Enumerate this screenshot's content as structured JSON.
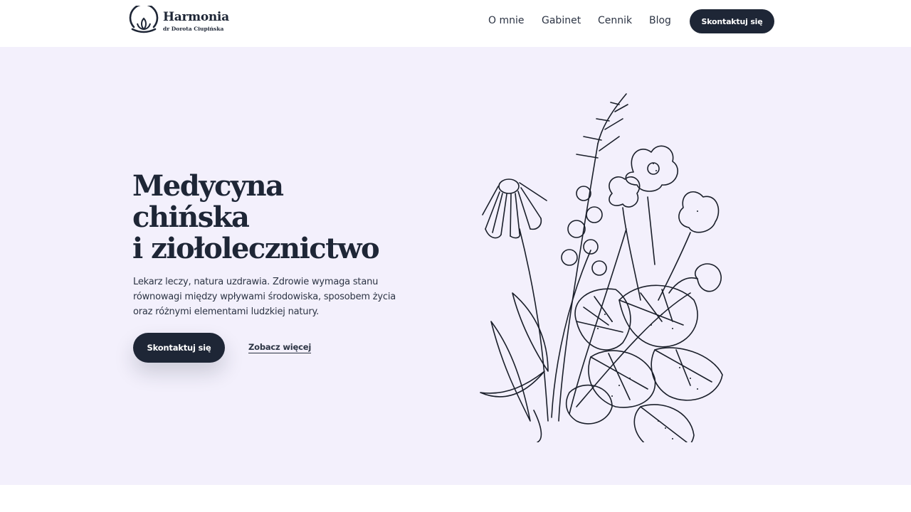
{
  "header": {
    "logo": {
      "name": "Harmonia",
      "subtitle": "dr Dorota Ciupińska",
      "icon": "lotus-sun-icon"
    },
    "nav": [
      {
        "label": "O mnie"
      },
      {
        "label": "Gabinet"
      },
      {
        "label": "Cennik"
      },
      {
        "label": "Blog"
      }
    ],
    "cta_label": "Skontaktuj się"
  },
  "hero": {
    "title_lines": [
      "Medycyna",
      "chińska",
      "i ziołolecznictwo"
    ],
    "text_lines": [
      "Lekarz leczy, natura uzdrawia. Zdrowie wymaga stanu",
      "równowagi między wpływami środowiska, sposobem życia",
      "oraz różnymi elementami ludzkiej natury."
    ],
    "primary_button": "Skontaktuj się",
    "secondary_link": "Zobacz więcej",
    "illustration": "herbal-flowers-illustration"
  },
  "colors": {
    "primary": "#1e2636",
    "hero_background": "#f3f0fc",
    "page_background": "#ffffff"
  }
}
